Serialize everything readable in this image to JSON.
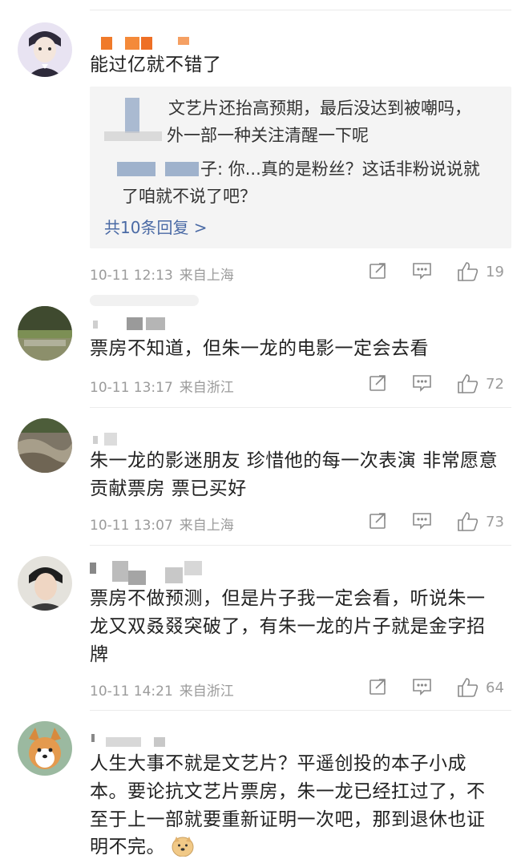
{
  "comments": [
    {
      "text": "能过亿就不错了",
      "time": "10-11 12:13",
      "location": "来自上海",
      "likes": "19",
      "replies": [
        {
          "text_visible": "文艺片还抬高预期，最后没达到被嘲吗，"
        },
        {
          "text_visible": "外一部一种关注清醒一下呢"
        },
        {
          "text_visible": "子: 你...真的是粉丝？这话非粉说说就"
        },
        {
          "text_visible": "了咱就不说了吧？"
        }
      ],
      "more_replies": "共10条回复 >"
    },
    {
      "text": "票房不知道，但朱一龙的电影一定会去看",
      "time": "10-11 13:17",
      "location": "来自浙江",
      "likes": "72"
    },
    {
      "text_line1": "朱一龙的影迷朋友 珍惜他的每一次表演 非常愿意",
      "text_line2": "贡献票房 票已买好",
      "time": "10-11 13:07",
      "location": "来自上海",
      "likes": "73"
    },
    {
      "text_line1": "票房不做预测，但是片子我一定会看，听说朱一",
      "text_line2": "龙又双叒叕突破了，有朱一龙的片子就是金字招",
      "text_line3": "牌",
      "time": "10-11 14:21",
      "location": "来自浙江",
      "likes": "64"
    },
    {
      "text_line1": "人生大事不就是文艺片？平遥创投的本子小成",
      "text_line2": "本。要论抗文艺片票房，朱一龙已经扛过了，不",
      "text_line3": "至于上一部就要重新证明一次吧，那到退休也证",
      "text_line4": "明不完。"
    }
  ],
  "colors": {
    "text": "#222222",
    "meta": "#9b9b9b",
    "link": "#4a6aa5",
    "reply_bg": "#f4f4f4"
  },
  "icons": [
    "share-icon",
    "comment-icon",
    "like-icon",
    "doge-emoji-icon"
  ]
}
